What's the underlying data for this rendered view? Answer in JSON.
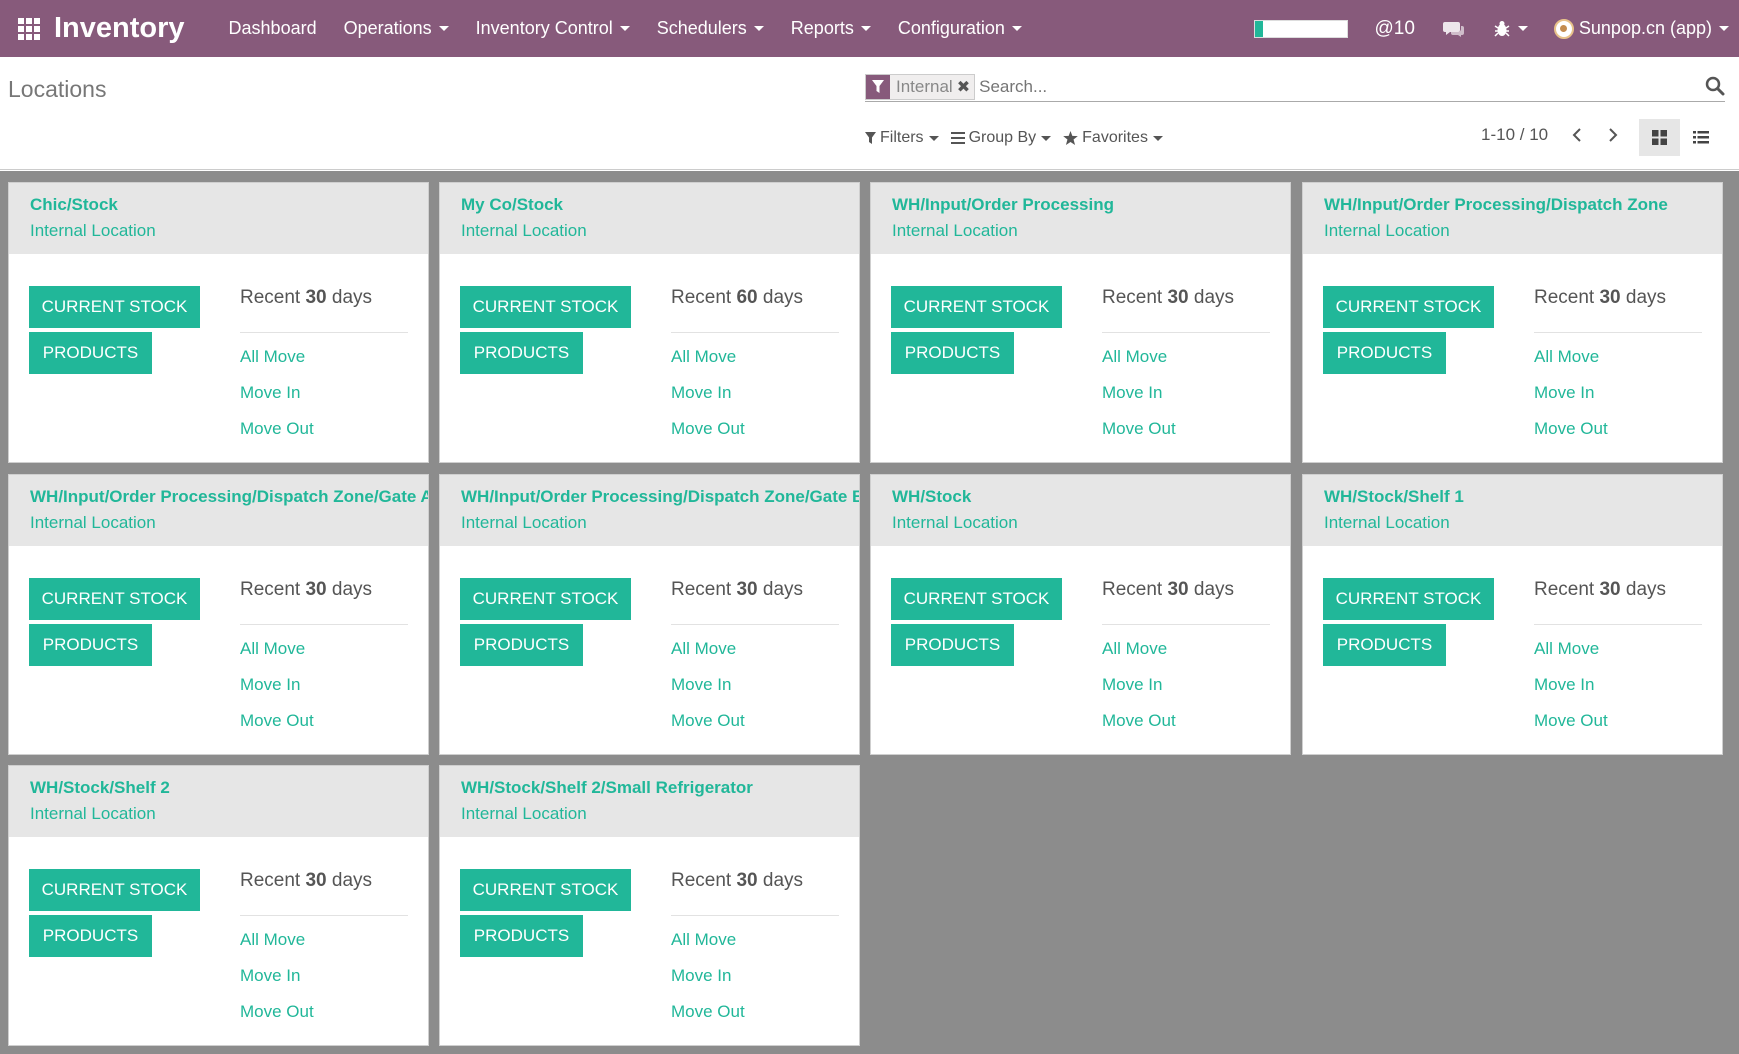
{
  "navbar": {
    "brand": "Inventory",
    "menu": [
      {
        "label": "Dashboard",
        "dropdown": false
      },
      {
        "label": "Operations",
        "dropdown": true
      },
      {
        "label": "Inventory Control",
        "dropdown": true
      },
      {
        "label": "Schedulers",
        "dropdown": true
      },
      {
        "label": "Reports",
        "dropdown": true
      },
      {
        "label": "Configuration",
        "dropdown": true
      }
    ],
    "progress_fraction": 0.08,
    "mentions": "@10",
    "user": "Sunpop.cn (app)"
  },
  "control": {
    "title": "Locations",
    "facet": "Internal",
    "search_placeholder": "Search...",
    "filters_label": "Filters",
    "groupby_label": "Group By",
    "favorites_label": "Favorites",
    "pager": "1-10 / 10"
  },
  "card_labels": {
    "current_stock": "CURRENT STOCK",
    "products": "PRODUCTS",
    "recent_prefix": "Recent",
    "recent_suffix": "days",
    "all_move": "All Move",
    "move_in": "Move In",
    "move_out": "Move Out"
  },
  "cards": [
    {
      "name": "Chic/Stock",
      "type": "Internal Location",
      "days": "30"
    },
    {
      "name": "My Co/Stock",
      "type": "Internal Location",
      "days": "60"
    },
    {
      "name": "WH/Input/Order Processing",
      "type": "Internal Location",
      "days": "30"
    },
    {
      "name": "WH/Input/Order Processing/Dispatch Zone",
      "type": "Internal Location",
      "days": "30"
    },
    {
      "name": "WH/Input/Order Processing/Dispatch Zone/Gate A",
      "type": "Internal Location",
      "days": "30"
    },
    {
      "name": "WH/Input/Order Processing/Dispatch Zone/Gate B",
      "type": "Internal Location",
      "days": "30"
    },
    {
      "name": "WH/Stock",
      "type": "Internal Location",
      "days": "30"
    },
    {
      "name": "WH/Stock/Shelf 1",
      "type": "Internal Location",
      "days": "30"
    },
    {
      "name": "WH/Stock/Shelf 2",
      "type": "Internal Location",
      "days": "30"
    },
    {
      "name": "WH/Stock/Shelf 2/Small Refrigerator",
      "type": "Internal Location",
      "days": "30"
    }
  ]
}
